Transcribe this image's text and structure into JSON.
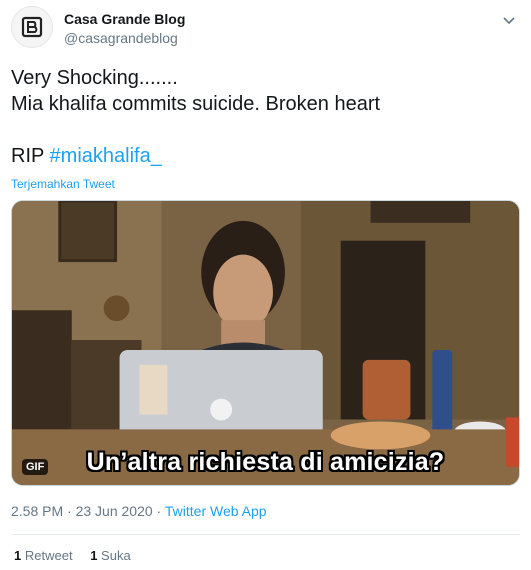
{
  "author": {
    "name": "Casa Grande Blog",
    "handle": "@casagrandeblog"
  },
  "tweet": {
    "line1": "Very Shocking.......",
    "line2": "Mia khalifa commits suicide. Broken heart",
    "rip": "RIP",
    "hashtag": "#miakhalifa_"
  },
  "translate_label": "Terjemahkan Tweet",
  "media": {
    "caption": "Un’altra richiesta di amicizia?",
    "badge": "GIF"
  },
  "meta": {
    "time": "2.58 PM",
    "sep": " · ",
    "date": "23 Jun 2020",
    "source": "Twitter Web App"
  },
  "stats": {
    "retweets_count": "1",
    "retweets_label": "Retweet",
    "likes_count": "1",
    "likes_label": "Suka"
  },
  "colors": {
    "link": "#1da1f2",
    "secondary_text": "#657786",
    "primary_text": "#14171a"
  },
  "icons": {
    "avatar": "casa-grande-logo-icon",
    "menu": "chevron-down-icon"
  }
}
